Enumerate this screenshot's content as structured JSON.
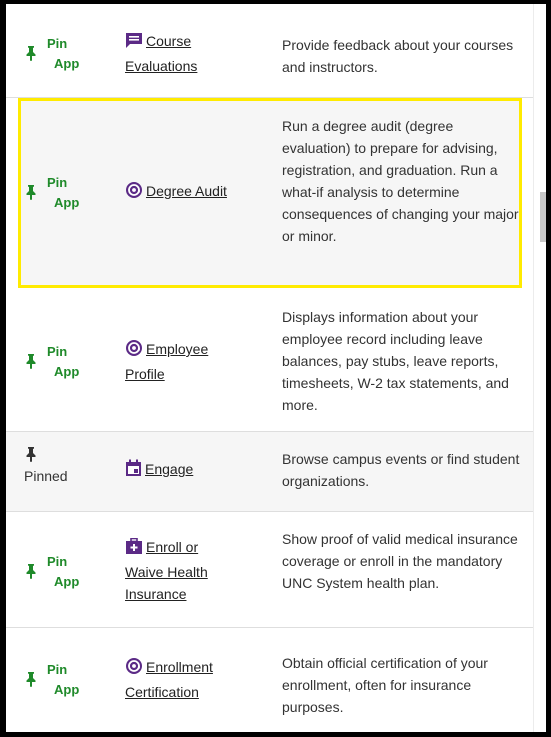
{
  "colors": {
    "pin_green": "#1f8a2a",
    "icon_purple": "#5b2a86",
    "highlight_yellow": "#ffeb00"
  },
  "pin_app": {
    "line1": "Pin",
    "line2": "App"
  },
  "pinned_label": "Pinned",
  "apps": [
    {
      "name_lines": [
        "Course",
        "Evaluations"
      ],
      "icon": "comment-icon",
      "description": "Provide feedback about your courses and instructors.",
      "state": "pin"
    },
    {
      "name_lines": [
        "Degree Audit"
      ],
      "icon": "at-sign-icon",
      "description": "Run a degree audit (degree evaluation) to prepare for advising, registration, and graduation. Run a what-if analysis to determine consequences of changing your major or minor.",
      "state": "pin",
      "highlighted": true
    },
    {
      "name_lines": [
        "Employee",
        "Profile"
      ],
      "icon": "at-sign-icon",
      "description": "Displays information about your employee record including leave balances, pay stubs, leave reports, timesheets, W-2 tax statements, and more.",
      "state": "pin"
    },
    {
      "name_lines": [
        "Engage"
      ],
      "icon": "calendar-icon",
      "description": "Browse campus events or find student organizations.",
      "state": "pinned"
    },
    {
      "name_lines": [
        "Enroll or",
        "Waive Health",
        "Insurance"
      ],
      "icon": "medical-kit-icon",
      "description": "Show proof of valid medical insurance coverage or enroll in the mandatory UNC System health plan.",
      "state": "pin"
    },
    {
      "name_lines": [
        "Enrollment",
        "Certification"
      ],
      "icon": "at-sign-icon",
      "description": "Obtain official certification of your enrollment, often for insurance purposes.",
      "state": "pin"
    }
  ]
}
